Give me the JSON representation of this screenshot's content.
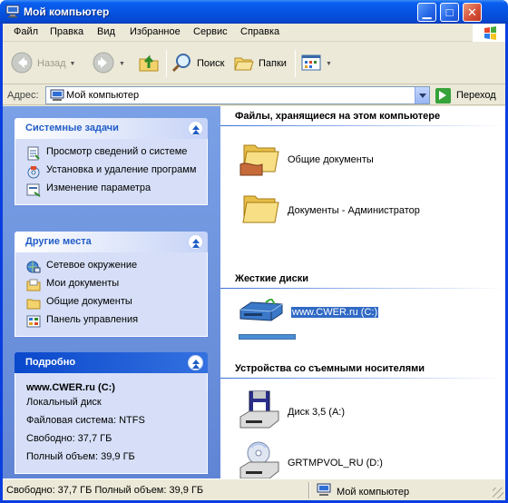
{
  "window": {
    "title": "Мой компьютер"
  },
  "menu": [
    "Файл",
    "Правка",
    "Вид",
    "Избранное",
    "Сервис",
    "Справка"
  ],
  "toolbar": {
    "back": "Назад",
    "search": "Поиск",
    "folders": "Папки"
  },
  "address": {
    "label": "Адрес:",
    "value": "Мой компьютер",
    "go": "Переход"
  },
  "left": {
    "system_tasks": {
      "title": "Системные задачи",
      "items": [
        {
          "label": "Просмотр сведений о системе",
          "icon": "system-info-icon"
        },
        {
          "label": "Установка и удаление программ",
          "icon": "add-remove-programs-icon"
        },
        {
          "label": "Изменение параметра",
          "icon": "control-panel-setting-icon"
        }
      ]
    },
    "other_places": {
      "title": "Другие места",
      "items": [
        {
          "label": "Сетевое окружение",
          "icon": "network-places-icon"
        },
        {
          "label": "Мои документы",
          "icon": "my-documents-icon"
        },
        {
          "label": "Общие документы",
          "icon": "shared-documents-icon"
        },
        {
          "label": "Панель управления",
          "icon": "control-panel-icon"
        }
      ]
    },
    "details": {
      "title": "Подробно",
      "name": "www.CWER.ru (C:)",
      "type": "Локальный диск",
      "fs": "Файловая система: NTFS",
      "free": "Свободно: 37,7 ГБ",
      "total": "Полный объем: 39,9 ГБ"
    }
  },
  "right": {
    "files": {
      "title": "Файлы, хранящиеся на этом компьютере",
      "items": [
        "Общие документы",
        "Документы - Администратор"
      ]
    },
    "hdd": {
      "title": "Жесткие диски",
      "items": [
        "www.CWER.ru (C:)"
      ],
      "used_fraction": 0.06
    },
    "removable": {
      "title": "Устройства со съемными носителями",
      "items": [
        "Диск 3,5 (A:)",
        "GRTMPVOL_RU (D:)"
      ]
    }
  },
  "status": {
    "left": "Свободно: 37,7 ГБ Полный объем: 39,9 ГБ",
    "right": "Мой компьютер"
  },
  "colors": {
    "titlebar": "#0654e2",
    "leftpane": "#6e94de",
    "selection": "#316ac5"
  }
}
